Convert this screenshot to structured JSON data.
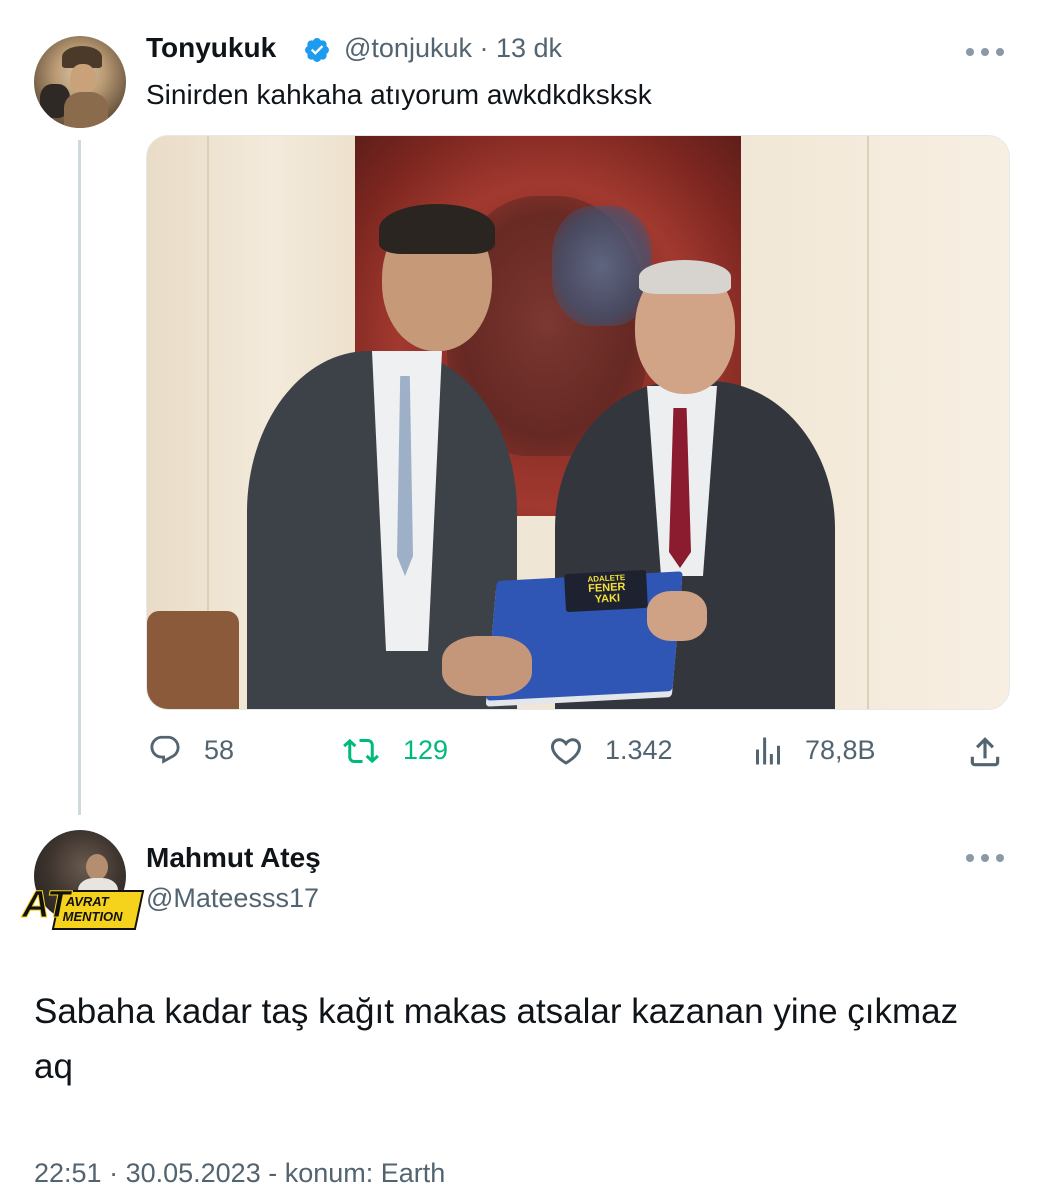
{
  "tweet": {
    "author_name": "Tonyukuk",
    "verified": true,
    "handle": "@tonjukuk",
    "time_sep": " · ",
    "time": "13 dk",
    "text": "Sinirden kahkaha atıyorum awkdkdksksk",
    "media": {
      "cd_line1": "ADALETE",
      "cd_line2": "FENER",
      "cd_line3": "YAKI"
    },
    "actions": {
      "replies": "58",
      "retweets": "129",
      "likes": "1.342",
      "views": "78,8B"
    },
    "icons": [
      "verified-badge-icon",
      "more-icon",
      "reply-icon",
      "retweet-icon",
      "like-icon",
      "views-icon",
      "share-icon"
    ]
  },
  "reply": {
    "author_name": "Mahmut Ateş",
    "handle": "@Mateesss17",
    "badge": {
      "at": "AT",
      "line1": "AVRAT",
      "line2": "MENTION"
    },
    "text": "Sabaha kadar taş kağıt makas atsalar kazanan yine çıkmaz aq",
    "time": "22:51",
    "sep1": " · ",
    "date": "30.05.2023",
    "sep2": " - ",
    "location": "konum: Earth"
  },
  "colors": {
    "text_primary": "#0f1419",
    "text_secondary": "#536471",
    "verified_blue": "#1d9bf0",
    "retweet_green": "#00ba7c",
    "thread_line": "#cfd9de"
  }
}
